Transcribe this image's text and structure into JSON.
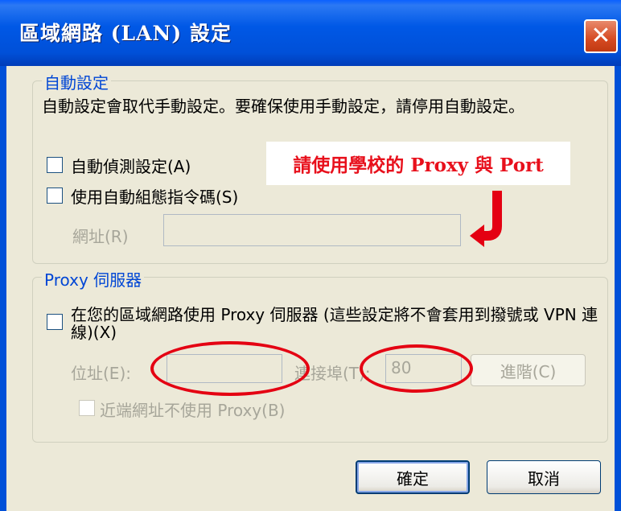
{
  "window": {
    "title": "區域網路 (LAN) 設定",
    "close_glyph": "✕"
  },
  "auto_config": {
    "legend": "自動設定",
    "description": "自動設定會取代手動設定。要確保使用手動設定，請停用自動設定。",
    "auto_detect_label": "自動偵測設定(A)",
    "auto_detect_checked": false,
    "use_script_label": "使用自動組態指令碼(S)",
    "use_script_checked": false,
    "address_label": "網址(R)",
    "address_value": ""
  },
  "proxy": {
    "legend": "Proxy 伺服器",
    "use_proxy_label": "在您的區域網路使用 Proxy 伺服器 (這些設定將不會套用到撥號或 VPN 連線)(X)",
    "use_proxy_checked": false,
    "address_label": "位址(E):",
    "address_value": "",
    "port_label": "連接埠(T):",
    "port_value": "80",
    "advanced_button": "進階(C)",
    "bypass_label": "近端網址不使用 Proxy(B)",
    "bypass_checked": false
  },
  "annotation": {
    "text": "請使用學校的 Proxy 與 Port",
    "color": "#e8101c"
  },
  "buttons": {
    "ok": "確定",
    "cancel": "取消"
  },
  "colors": {
    "titlebar": "#0050d8",
    "dialog_bg": "#ece9d8",
    "legend_text": "#0046d5",
    "annotation_red": "#e40012"
  }
}
